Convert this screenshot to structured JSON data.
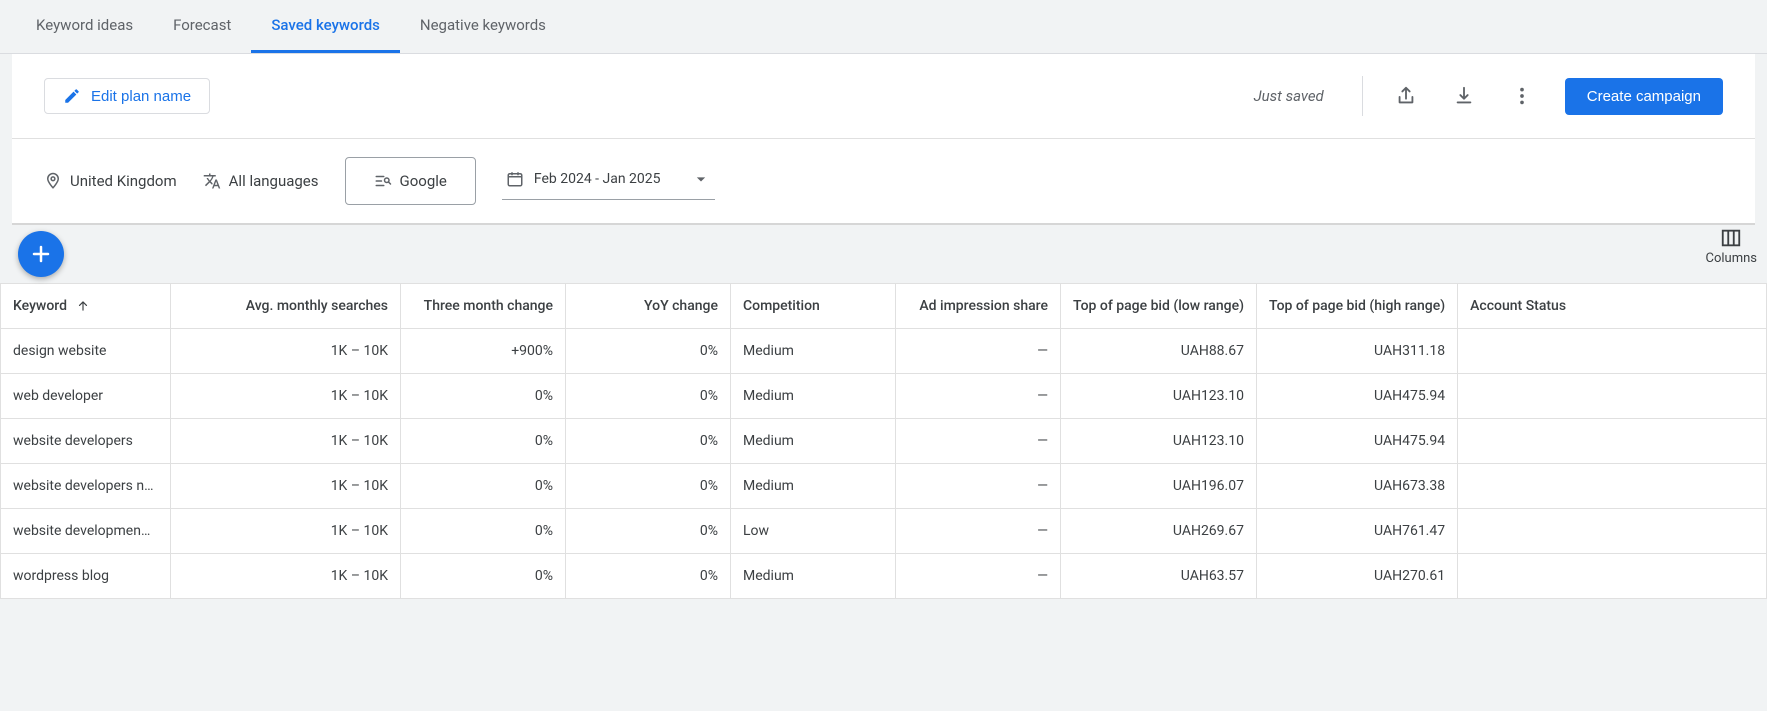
{
  "tabs": [
    {
      "label": "Keyword ideas",
      "active": false
    },
    {
      "label": "Forecast",
      "active": false
    },
    {
      "label": "Saved keywords",
      "active": true
    },
    {
      "label": "Negative keywords",
      "active": false
    }
  ],
  "toolbar": {
    "edit_label": "Edit plan name",
    "status": "Just saved",
    "create_label": "Create campaign"
  },
  "filters": {
    "location": "United Kingdom",
    "language": "All languages",
    "network": "Google",
    "daterange": "Feb 2024 - Jan 2025"
  },
  "columns_label": "Columns",
  "table": {
    "headers": {
      "keyword": "Keyword",
      "avg": "Avg. monthly searches",
      "three_month": "Three month change",
      "yoy": "YoY change",
      "competition": "Competition",
      "ad_share": "Ad impression share",
      "bid_low": "Top of page bid (low range)",
      "bid_high": "Top of page bid (high range)",
      "account": "Account Status"
    },
    "rows": [
      {
        "keyword": "design website",
        "avg": "1K – 10K",
        "three_month": "+900%",
        "yoy": "0%",
        "competition": "Medium",
        "ad_share": "—",
        "bid_low": "UAH88.67",
        "bid_high": "UAH311.18",
        "account": ""
      },
      {
        "keyword": "web developer",
        "avg": "1K – 10K",
        "three_month": "0%",
        "yoy": "0%",
        "competition": "Medium",
        "ad_share": "—",
        "bid_low": "UAH123.10",
        "bid_high": "UAH475.94",
        "account": ""
      },
      {
        "keyword": "website developers",
        "avg": "1K – 10K",
        "three_month": "0%",
        "yoy": "0%",
        "competition": "Medium",
        "ad_share": "—",
        "bid_low": "UAH123.10",
        "bid_high": "UAH475.94",
        "account": ""
      },
      {
        "keyword": "website developers n…",
        "avg": "1K – 10K",
        "three_month": "0%",
        "yoy": "0%",
        "competition": "Medium",
        "ad_share": "—",
        "bid_low": "UAH196.07",
        "bid_high": "UAH673.38",
        "account": ""
      },
      {
        "keyword": "website developmen…",
        "avg": "1K – 10K",
        "three_month": "0%",
        "yoy": "0%",
        "competition": "Low",
        "ad_share": "—",
        "bid_low": "UAH269.67",
        "bid_high": "UAH761.47",
        "account": ""
      },
      {
        "keyword": "wordpress blog",
        "avg": "1K – 10K",
        "three_month": "0%",
        "yoy": "0%",
        "competition": "Medium",
        "ad_share": "—",
        "bid_low": "UAH63.57",
        "bid_high": "UAH270.61",
        "account": ""
      }
    ]
  }
}
